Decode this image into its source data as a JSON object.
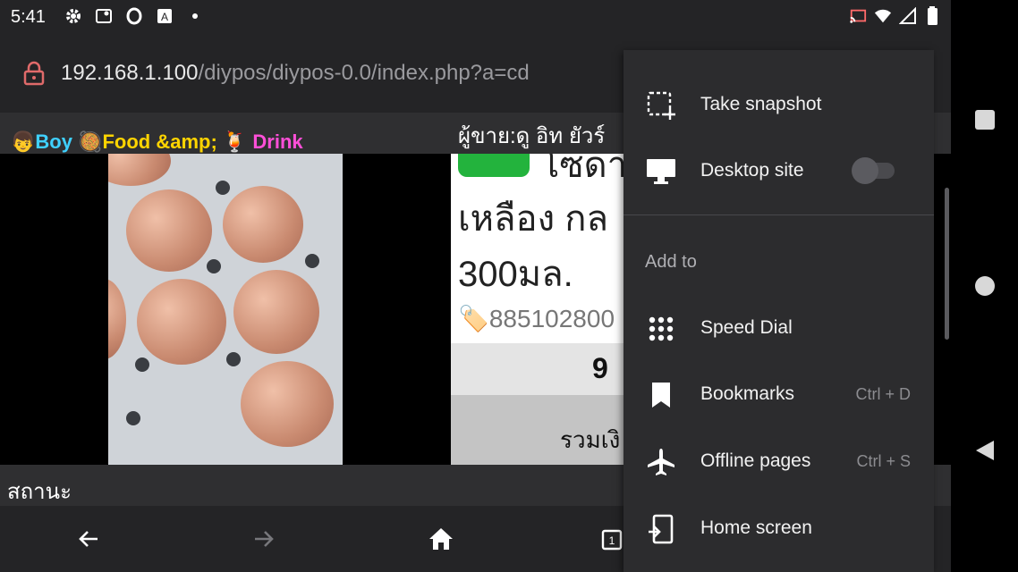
{
  "status_bar": {
    "time": "5:41",
    "left_icons": [
      "gear-icon",
      "photo-location-icon",
      "opera-icon",
      "a-icon",
      "dot-icon"
    ],
    "right_icons": [
      "cast-icon",
      "wifi-icon",
      "signal-icon",
      "battery-icon"
    ]
  },
  "url_bar": {
    "host": "192.168.1.100",
    "path": "/diypos/diypos-0.0/index.php?a=cd"
  },
  "page": {
    "brand_boy": "👦Boy ",
    "brand_food": "🥘Food &amp; ",
    "brand_drink": "🍹 Drink",
    "seller": "ผู้ขาย:ดู อิท ยัวร์",
    "product": {
      "badge_text": "โซดา",
      "name_line1": "เหลือง กล",
      "name_line2": "300มล.",
      "barcode": "🏷️885102800",
      "quantity": "9",
      "total_label": "รวมเงิ"
    },
    "status_label": "สถานะ"
  },
  "bottom_bar": {
    "tab_count": "1"
  },
  "menu": {
    "take_snapshot": "Take snapshot",
    "desktop_site": "Desktop site",
    "desktop_site_enabled": false,
    "section_add_to": "Add to",
    "speed_dial": "Speed Dial",
    "bookmarks": "Bookmarks",
    "bookmarks_shortcut": "Ctrl + D",
    "offline_pages": "Offline pages",
    "offline_pages_shortcut": "Ctrl + S",
    "home_screen": "Home screen"
  },
  "colors": {
    "chrome_bg": "#242426",
    "menu_bg": "#2c2c2e",
    "lock_red": "#e06a6a",
    "accent_green": "#23b33d"
  }
}
